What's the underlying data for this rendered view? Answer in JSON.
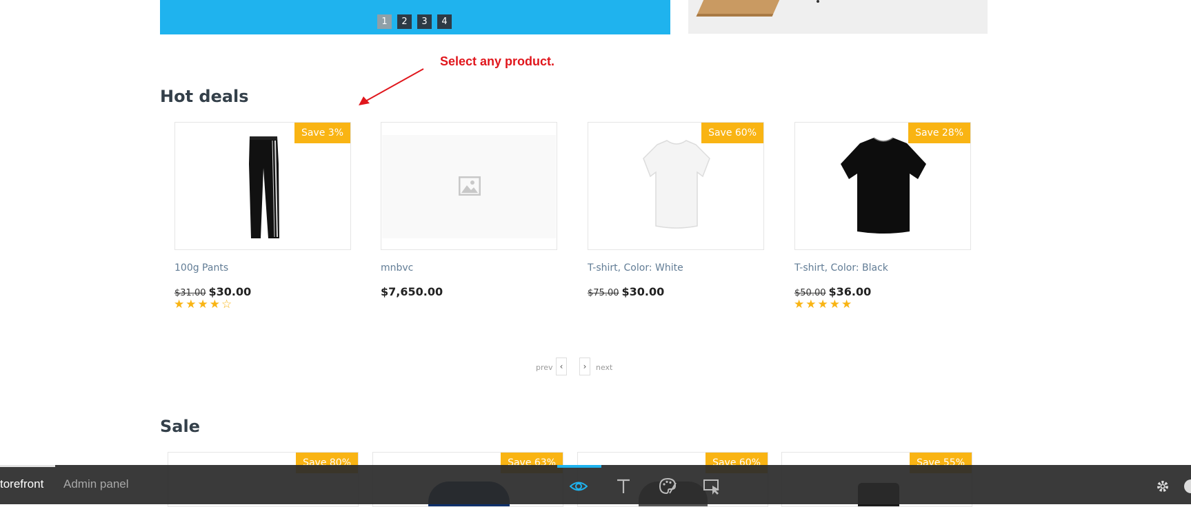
{
  "banner": {
    "pages": [
      "1",
      "2",
      "3",
      "4"
    ],
    "active_page": "1"
  },
  "annotation": {
    "text": "Select any product."
  },
  "hot_deals": {
    "title": "Hot deals",
    "products": [
      {
        "name": "100g Pants",
        "badge": "Save 3%",
        "old_price": "$31.00",
        "price": "$30.00",
        "rating": 4,
        "image": "pants"
      },
      {
        "name": "mnbvc",
        "badge": "",
        "old_price": "",
        "price": "$7,650.00",
        "rating": 0,
        "image": "placeholder"
      },
      {
        "name": "T-shirt, Color: White",
        "badge": "Save 60%",
        "old_price": "$75.00",
        "price": "$30.00",
        "rating": 0,
        "image": "white-tshirt"
      },
      {
        "name": "T-shirt, Color: Black",
        "badge": "Save 28%",
        "old_price": "$50.00",
        "price": "$36.00",
        "rating": 5,
        "image": "black-tshirt"
      }
    ],
    "pager": {
      "prev": "prev",
      "next": "next"
    }
  },
  "sale": {
    "title": "Sale",
    "badges": [
      "Save 80%",
      "Save 63%",
      "Save 60%",
      "Save 55%"
    ]
  },
  "bottom_bar": {
    "storefront": "torefront",
    "admin_panel": "Admin panel",
    "tools": [
      "eye-icon",
      "text-icon",
      "palette-icon",
      "cursor-select-icon"
    ],
    "accent_color": "#1fb3ee"
  },
  "colors": {
    "badge": "#f9b413",
    "banner": "#1fb3ee",
    "annotation": "#e0161c"
  }
}
